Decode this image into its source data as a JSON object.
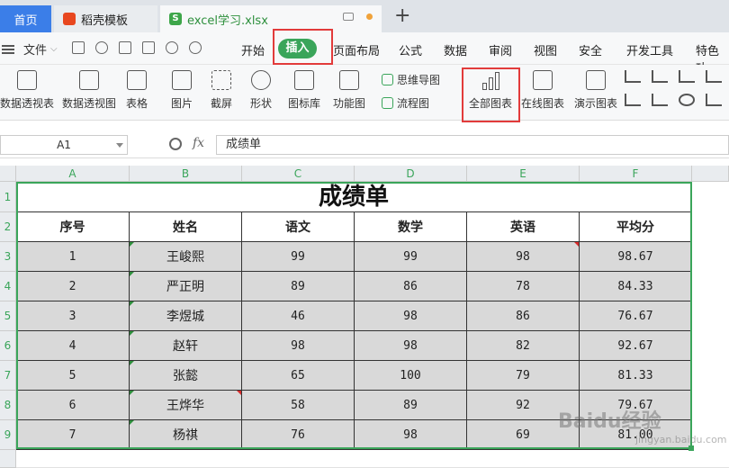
{
  "tabs": {
    "home": "首页",
    "daoke": "稻壳模板",
    "file": "excel学习.xlsx",
    "new_tab": "+"
  },
  "menu": {
    "file": "文件",
    "items": [
      "开始",
      "插入",
      "页面布局",
      "公式",
      "数据",
      "审阅",
      "视图",
      "安全",
      "开发工具",
      "特色功"
    ]
  },
  "ribbon": {
    "pivot_table": "数据透视表",
    "pivot_chart": "数据透视图",
    "table": "表格",
    "picture": "图片",
    "screenshot": "截屏",
    "shape": "形状",
    "icon_lib": "图标库",
    "func_chart": "功能图",
    "mindmap": "思维导图",
    "flowchart": "流程图",
    "all_charts": "全部图表",
    "online_chart": "在线图表",
    "demo_chart": "演示图表"
  },
  "formula_bar": {
    "name_box": "A1",
    "fx": "fx",
    "content": "成绩单"
  },
  "sheet": {
    "columns": [
      "A",
      "B",
      "C",
      "D",
      "E",
      "F"
    ],
    "rows": [
      "1",
      "2",
      "3",
      "4",
      "5",
      "6",
      "7",
      "8",
      "9"
    ],
    "title": "成绩单",
    "headers": [
      "序号",
      "姓名",
      "语文",
      "数学",
      "英语",
      "平均分"
    ],
    "data": [
      [
        "1",
        "王峻熙",
        "99",
        "99",
        "98",
        "98.67"
      ],
      [
        "2",
        "严正明",
        "89",
        "86",
        "78",
        "84.33"
      ],
      [
        "3",
        "李煜城",
        "46",
        "98",
        "86",
        "76.67"
      ],
      [
        "4",
        "赵轩",
        "98",
        "98",
        "82",
        "92.67"
      ],
      [
        "5",
        "张懿",
        "65",
        "100",
        "79",
        "81.33"
      ],
      [
        "6",
        "王烨华",
        "58",
        "89",
        "92",
        "79.67"
      ],
      [
        "7",
        "杨祺",
        "76",
        "98",
        "69",
        "81.00"
      ]
    ]
  },
  "watermark": {
    "text": "Baidu经验",
    "url": "jingyan.baidu.com"
  },
  "colors": {
    "accent": "#3aa55a",
    "tab_blue": "#3b7ee8",
    "highlight": "#e23b3b",
    "cell_fill": "#d9d9d9"
  }
}
